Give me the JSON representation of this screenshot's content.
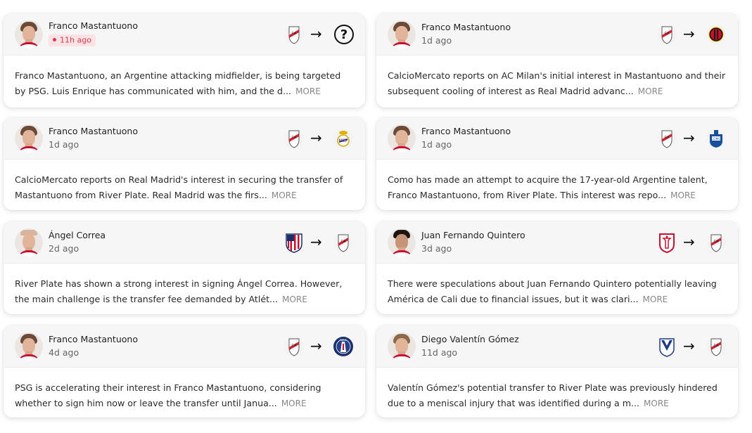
{
  "cards": [
    {
      "player": "Franco Mastantuono",
      "time": "11h ago",
      "recent": true,
      "from_icon": "river-plate-crest-icon",
      "to_icon": "unknown-club-icon",
      "text": "Franco Mastantuono, an Argentine attacking midfielder, is being targeted by PSG. Luis Enrique has communicated with him, and the d...",
      "more": "MORE"
    },
    {
      "player": "Franco Mastantuono",
      "time": "1d ago",
      "recent": false,
      "from_icon": "river-plate-crest-icon",
      "to_icon": "ac-milan-crest-icon",
      "text": "CalcioMercato reports on AC Milan's initial interest in Mastantuono and their subsequent cooling of interest as Real Madrid advanc...",
      "more": "MORE"
    },
    {
      "player": "Franco Mastantuono",
      "time": "1d ago",
      "recent": false,
      "from_icon": "river-plate-crest-icon",
      "to_icon": "real-madrid-crest-icon",
      "text": "CalcioMercato reports on Real Madrid's interest in securing the transfer of Mastantuono from River Plate. Real Madrid was the firs...",
      "more": "MORE"
    },
    {
      "player": "Franco Mastantuono",
      "time": "1d ago",
      "recent": false,
      "from_icon": "river-plate-crest-icon",
      "to_icon": "como-crest-icon",
      "text": "Como has made an attempt to acquire the 17-year-old Argentine talent, Franco Mastantuono, from River Plate. This interest was repo...",
      "more": "MORE"
    },
    {
      "player": "Ángel Correa",
      "time": "2d ago",
      "recent": false,
      "from_icon": "atletico-madrid-crest-icon",
      "to_icon": "river-plate-crest-icon",
      "text": "River Plate has shown a strong interest in signing Ángel Correa. However, the main challenge is the transfer fee demanded by Atlét...",
      "more": "MORE"
    },
    {
      "player": "Juan Fernando Quintero",
      "time": "3d ago",
      "recent": false,
      "from_icon": "america-de-cali-crest-icon",
      "to_icon": "river-plate-crest-icon",
      "text": "There were speculations about Juan Fernando Quintero potentially leaving América de Cali due to financial issues, but it was clari...",
      "more": "MORE"
    },
    {
      "player": "Franco Mastantuono",
      "time": "4d ago",
      "recent": false,
      "from_icon": "river-plate-crest-icon",
      "to_icon": "psg-crest-icon",
      "text": "PSG is accelerating their interest in Franco Mastantuono, considering whether to sign him now or leave the transfer until Janua...",
      "more": "MORE"
    },
    {
      "player": "Diego Valentín Gómez",
      "time": "11d ago",
      "recent": false,
      "from_icon": "velez-sarsfield-crest-icon",
      "to_icon": "river-plate-crest-icon",
      "text": "Valentín Gómez's potential transfer to River Plate was previously hindered due to a meniscal injury that was identified during a m...",
      "more": "MORE"
    }
  ],
  "arrow": "→",
  "unknown_glyph": "?",
  "colors": {
    "recent_badge_bg": "#fde2e5",
    "recent_badge_text": "#d83a4a",
    "more_link": "#888888",
    "card_header_bg": "#f6f6f7"
  }
}
